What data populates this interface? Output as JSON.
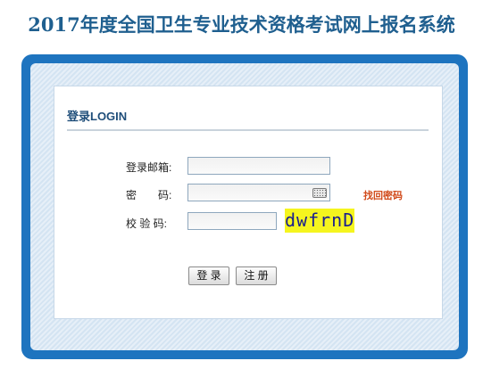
{
  "page": {
    "title": "2017年度全国卫生专业技术资格考试网上报名系统"
  },
  "login": {
    "heading": "登录LOGIN",
    "email_label": "登录邮箱:",
    "email_value": "",
    "password_label": "密　　码:",
    "password_value": "",
    "captcha_label": "校 验 码:",
    "captcha_value": "",
    "captcha_text": "dwfrnD",
    "forgot_link": "找回密码",
    "login_button": "登 录",
    "register_button": "注 册"
  },
  "colors": {
    "title": "#1f5f8f",
    "frame": "#1e74bf",
    "forgot_link": "#d14a1a",
    "captcha_bg": "#f5f51e",
    "captcha_text": "#1a1f8f"
  },
  "icons": {
    "password_field": "keyboard-icon"
  }
}
